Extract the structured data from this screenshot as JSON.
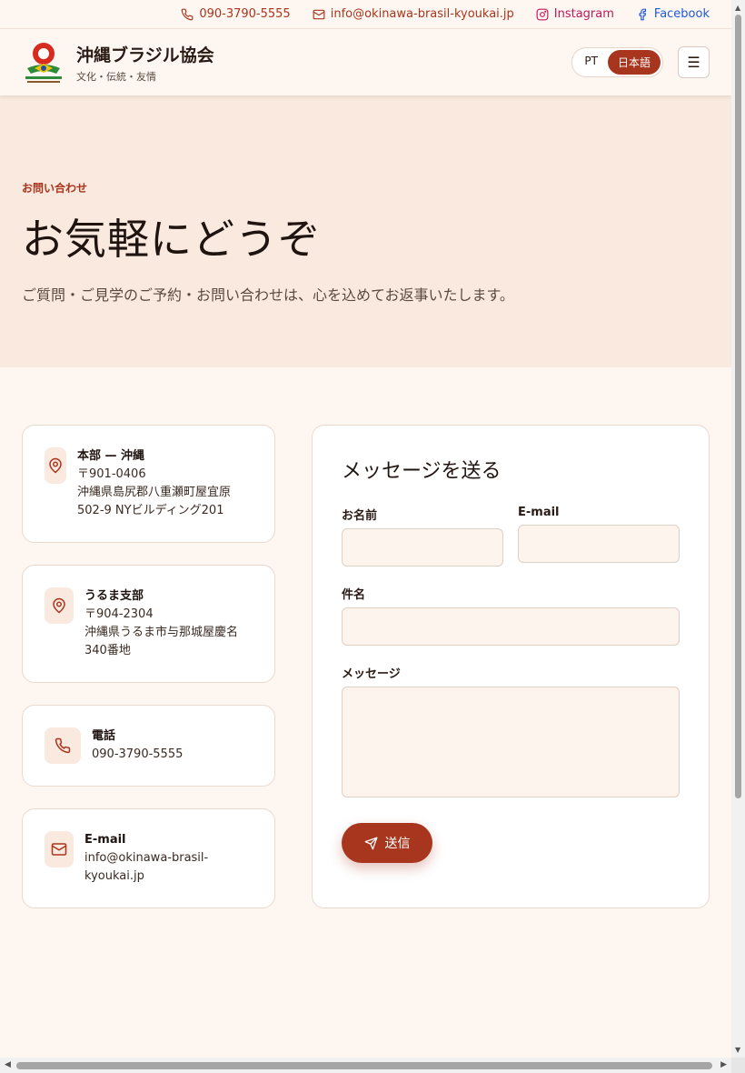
{
  "topbar": {
    "phone": "090-3790-5555",
    "email": "info@okinawa-brasil-kyoukai.jp",
    "instagram": "Instagram",
    "facebook": "Facebook"
  },
  "header": {
    "brand_name": "沖縄ブラジル協会",
    "brand_tagline": "文化・伝統・友情",
    "lang_pt": "PT",
    "lang_ja": "日本語",
    "menu_icon": "☰"
  },
  "hero": {
    "eyebrow": "お問い合わせ",
    "title": "お気軽にどうぞ",
    "subtitle": "ご質問・ご見学のご予約・お問い合わせは、心を込めてお返事いたします。"
  },
  "contacts": {
    "hq": {
      "title": "本部 — 沖縄",
      "line1": "〒901-0406",
      "line2": "沖縄県島尻郡八重瀬町屋宜原",
      "line3": "502-9 NYビルディング201"
    },
    "uruma": {
      "title": "うるま支部",
      "line1": "〒904-2304",
      "line2": "沖縄県うるま市与那城屋慶名",
      "line3": "340番地"
    },
    "phone": {
      "title": "電話",
      "value": "090-3790-5555"
    },
    "email": {
      "title": "E-mail",
      "line1": "info@okinawa-brasil-",
      "line2": "kyoukai.jp"
    }
  },
  "form": {
    "title": "メッセージを送る",
    "name_label": "お名前",
    "email_label": "E-mail",
    "subject_label": "件名",
    "message_label": "メッセージ",
    "submit_label": "送信"
  },
  "colors": {
    "accent": "#a8361e",
    "hero_bg": "#f9e9de",
    "page_bg": "#fdf6f1"
  }
}
